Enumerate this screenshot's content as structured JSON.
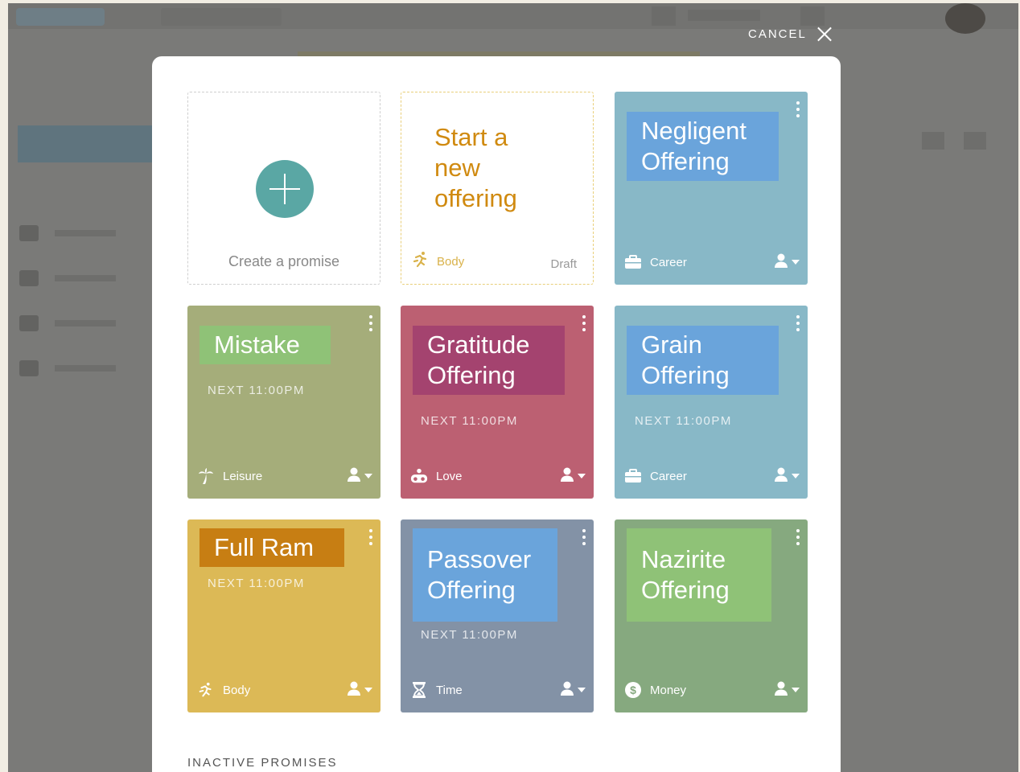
{
  "cancel": {
    "label": "CANCEL"
  },
  "create": {
    "label": "Create a promise"
  },
  "draft": {
    "title": "Start a new offering",
    "category": "Body",
    "status": "Draft"
  },
  "cards": [
    {
      "title": "Negligent Offering",
      "next": "",
      "category": "Career",
      "bg": "#88b8c7",
      "title_bg": "#6aa4db"
    },
    {
      "title": "Mistake",
      "next": "NEXT 11:00PM",
      "category": "Leisure",
      "bg": "#a5ad7a",
      "title_bg": "#8fc277"
    },
    {
      "title": "Gratitude Offering",
      "next": "NEXT 11:00PM",
      "category": "Love",
      "bg": "#bc6072",
      "title_bg": "#a4436f"
    },
    {
      "title": "Grain Offering",
      "next": "NEXT 11:00PM",
      "category": "Career",
      "bg": "#88b8c7",
      "title_bg": "#6aa4db"
    },
    {
      "title": "Full Ram",
      "next": "NEXT 11:00PM",
      "category": "Body",
      "bg": "#dcb956",
      "title_bg": "#c77e13"
    },
    {
      "title": "Passover Offering",
      "next": "NEXT 11:00PM",
      "category": "Time",
      "bg": "#8392a6",
      "title_bg": "#6aa4db"
    },
    {
      "title": "Nazirite Offering",
      "next": "",
      "category": "Money",
      "bg": "#86a97f",
      "title_bg": "#8fc277"
    }
  ],
  "inactive": {
    "label": "INACTIVE PROMISES"
  }
}
